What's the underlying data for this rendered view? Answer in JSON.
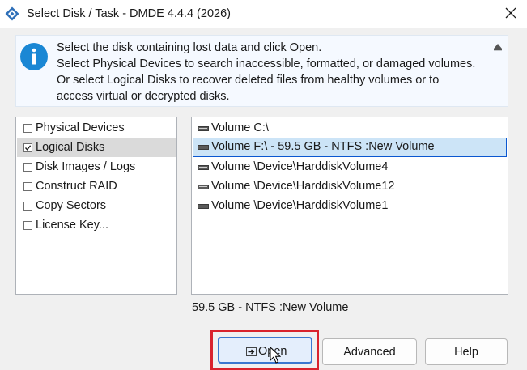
{
  "window": {
    "title": "Select Disk / Task - DMDE 4.4.4 (2026)"
  },
  "info": {
    "lines": [
      "Select the disk containing lost data and click Open.",
      "Select Physical Devices to search inaccessible, formatted, or damaged volumes.",
      "Or select Logical Disks to recover deleted files from healthy volumes or to",
      "access virtual or decrypted disks."
    ]
  },
  "tasks": {
    "items": [
      {
        "label": "Physical Devices",
        "checked": false
      },
      {
        "label": "Logical Disks",
        "checked": true
      },
      {
        "label": "Disk Images / Logs",
        "checked": false
      },
      {
        "label": "Construct RAID",
        "checked": false
      },
      {
        "label": "Copy Sectors",
        "checked": false
      },
      {
        "label": "License Key...",
        "checked": false
      }
    ]
  },
  "volumes": {
    "items": [
      {
        "label": "Volume C:\\"
      },
      {
        "label": "Volume F:\\ - 59.5 GB - NTFS :New Volume"
      },
      {
        "label": "Volume \\Device\\HarddiskVolume4"
      },
      {
        "label": "Volume \\Device\\HarddiskVolume12"
      },
      {
        "label": "Volume \\Device\\HarddiskVolume1"
      }
    ]
  },
  "status": {
    "text": "59.5 GB - NTFS :New Volume"
  },
  "buttons": {
    "open": "Open",
    "advanced": "Advanced",
    "help": "Help"
  },
  "colors": {
    "accent": "#0b57d0",
    "selection": "#cce4f7",
    "highlight": "#d9232d",
    "info_blue": "#1a87d4"
  },
  "icons": {
    "app": "dmde-logo-icon",
    "close": "close-icon",
    "info": "info-icon",
    "collapse": "triangle-up-icon",
    "drive": "drive-icon",
    "open": "arrow-right-icon",
    "cursor": "mouse-pointer-icon"
  }
}
